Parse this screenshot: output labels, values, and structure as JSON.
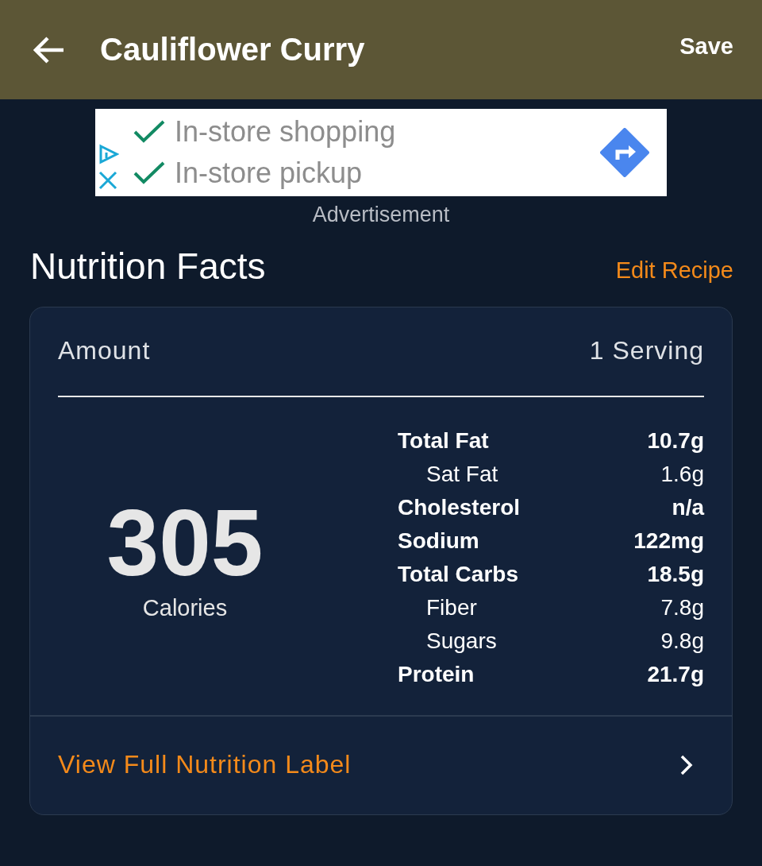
{
  "app_bar": {
    "title": "Cauliflower Curry",
    "action": "Save"
  },
  "ad": {
    "lines": [
      "In-store shopping",
      "In-store pickup"
    ],
    "caption": "Advertisement"
  },
  "section": {
    "title": "Nutrition Facts",
    "action": "Edit Recipe"
  },
  "card": {
    "amount_label": "Amount",
    "amount_value": "1 Serving",
    "calories": "305",
    "calories_label": "Calories",
    "nutrients": [
      {
        "kind": "main",
        "name": "Total Fat",
        "value": "10.7g"
      },
      {
        "kind": "sub",
        "name": "Sat Fat",
        "value": "1.6g"
      },
      {
        "kind": "main",
        "name": "Cholesterol",
        "value": "n/a"
      },
      {
        "kind": "main",
        "name": "Sodium",
        "value": "122mg"
      },
      {
        "kind": "main",
        "name": "Total Carbs",
        "value": "18.5g"
      },
      {
        "kind": "sub",
        "name": "Fiber",
        "value": "7.8g"
      },
      {
        "kind": "sub",
        "name": "Sugars",
        "value": "9.8g"
      },
      {
        "kind": "main",
        "name": "Protein",
        "value": "21.7g"
      }
    ],
    "link": "View Full Nutrition Label"
  }
}
